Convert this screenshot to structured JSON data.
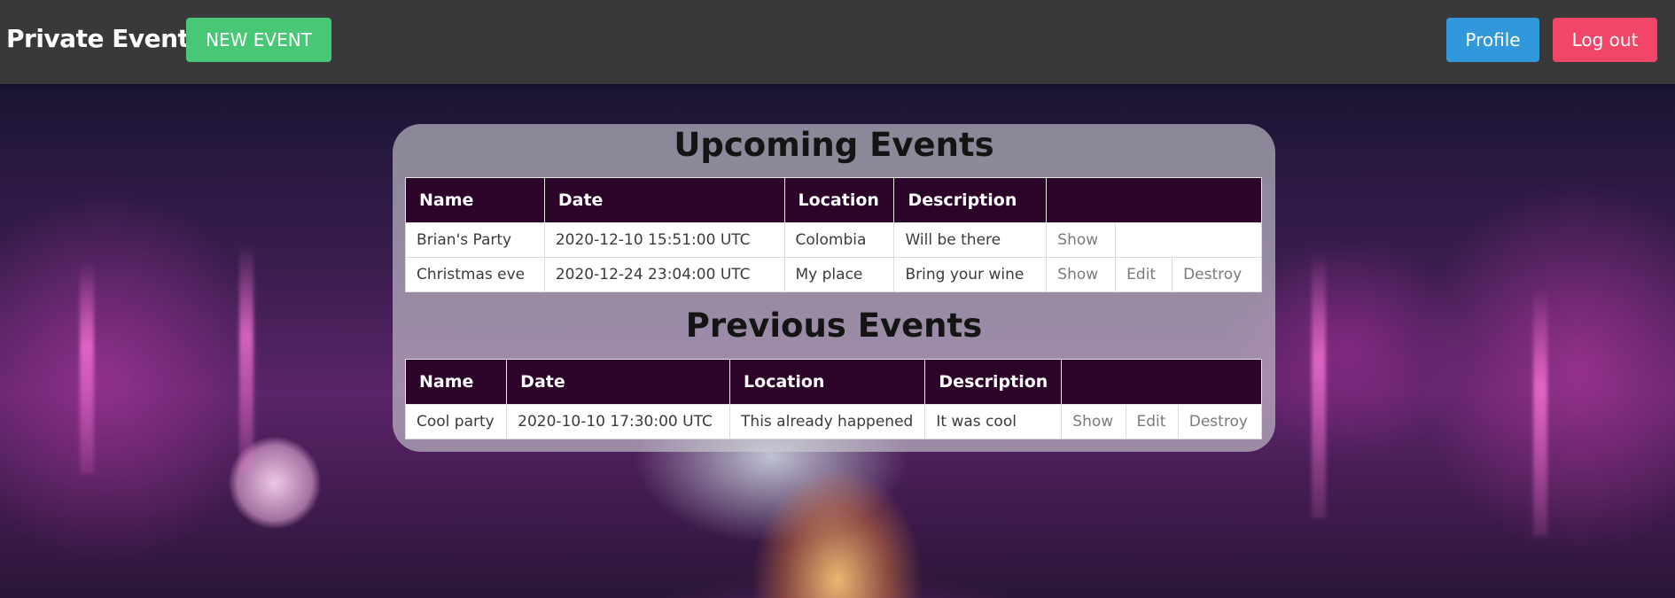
{
  "nav": {
    "brand": "Private Events",
    "new_event_label": "NEW EVENT",
    "profile_label": "Profile",
    "logout_label": "Log out"
  },
  "upcoming": {
    "title": "Upcoming Events",
    "columns": [
      "Name",
      "Date",
      "Location",
      "Description",
      ""
    ],
    "rows": [
      {
        "name": "Brian's Party",
        "date": "2020-12-10 15:51:00 UTC",
        "location": "Colombia",
        "description": "Will be there",
        "actions": [
          "Show"
        ]
      },
      {
        "name": "Christmas eve",
        "date": "2020-12-24 23:04:00 UTC",
        "location": "My place",
        "description": "Bring your wine",
        "actions": [
          "Show",
          "Edit",
          "Destroy"
        ]
      }
    ]
  },
  "previous": {
    "title": "Previous Events",
    "columns": [
      "Name",
      "Date",
      "Location",
      "Description",
      ""
    ],
    "rows": [
      {
        "name": "Cool party",
        "date": "2020-10-10 17:30:00 UTC",
        "location": "This already happened",
        "description": "It was cool",
        "actions": [
          "Show",
          "Edit",
          "Destroy"
        ]
      }
    ]
  },
  "colors": {
    "topbar": "#393939",
    "new_event_button": "#48c774",
    "profile_button": "#3298dc",
    "logout_button": "#f14668",
    "table_header": "#2c0429"
  }
}
